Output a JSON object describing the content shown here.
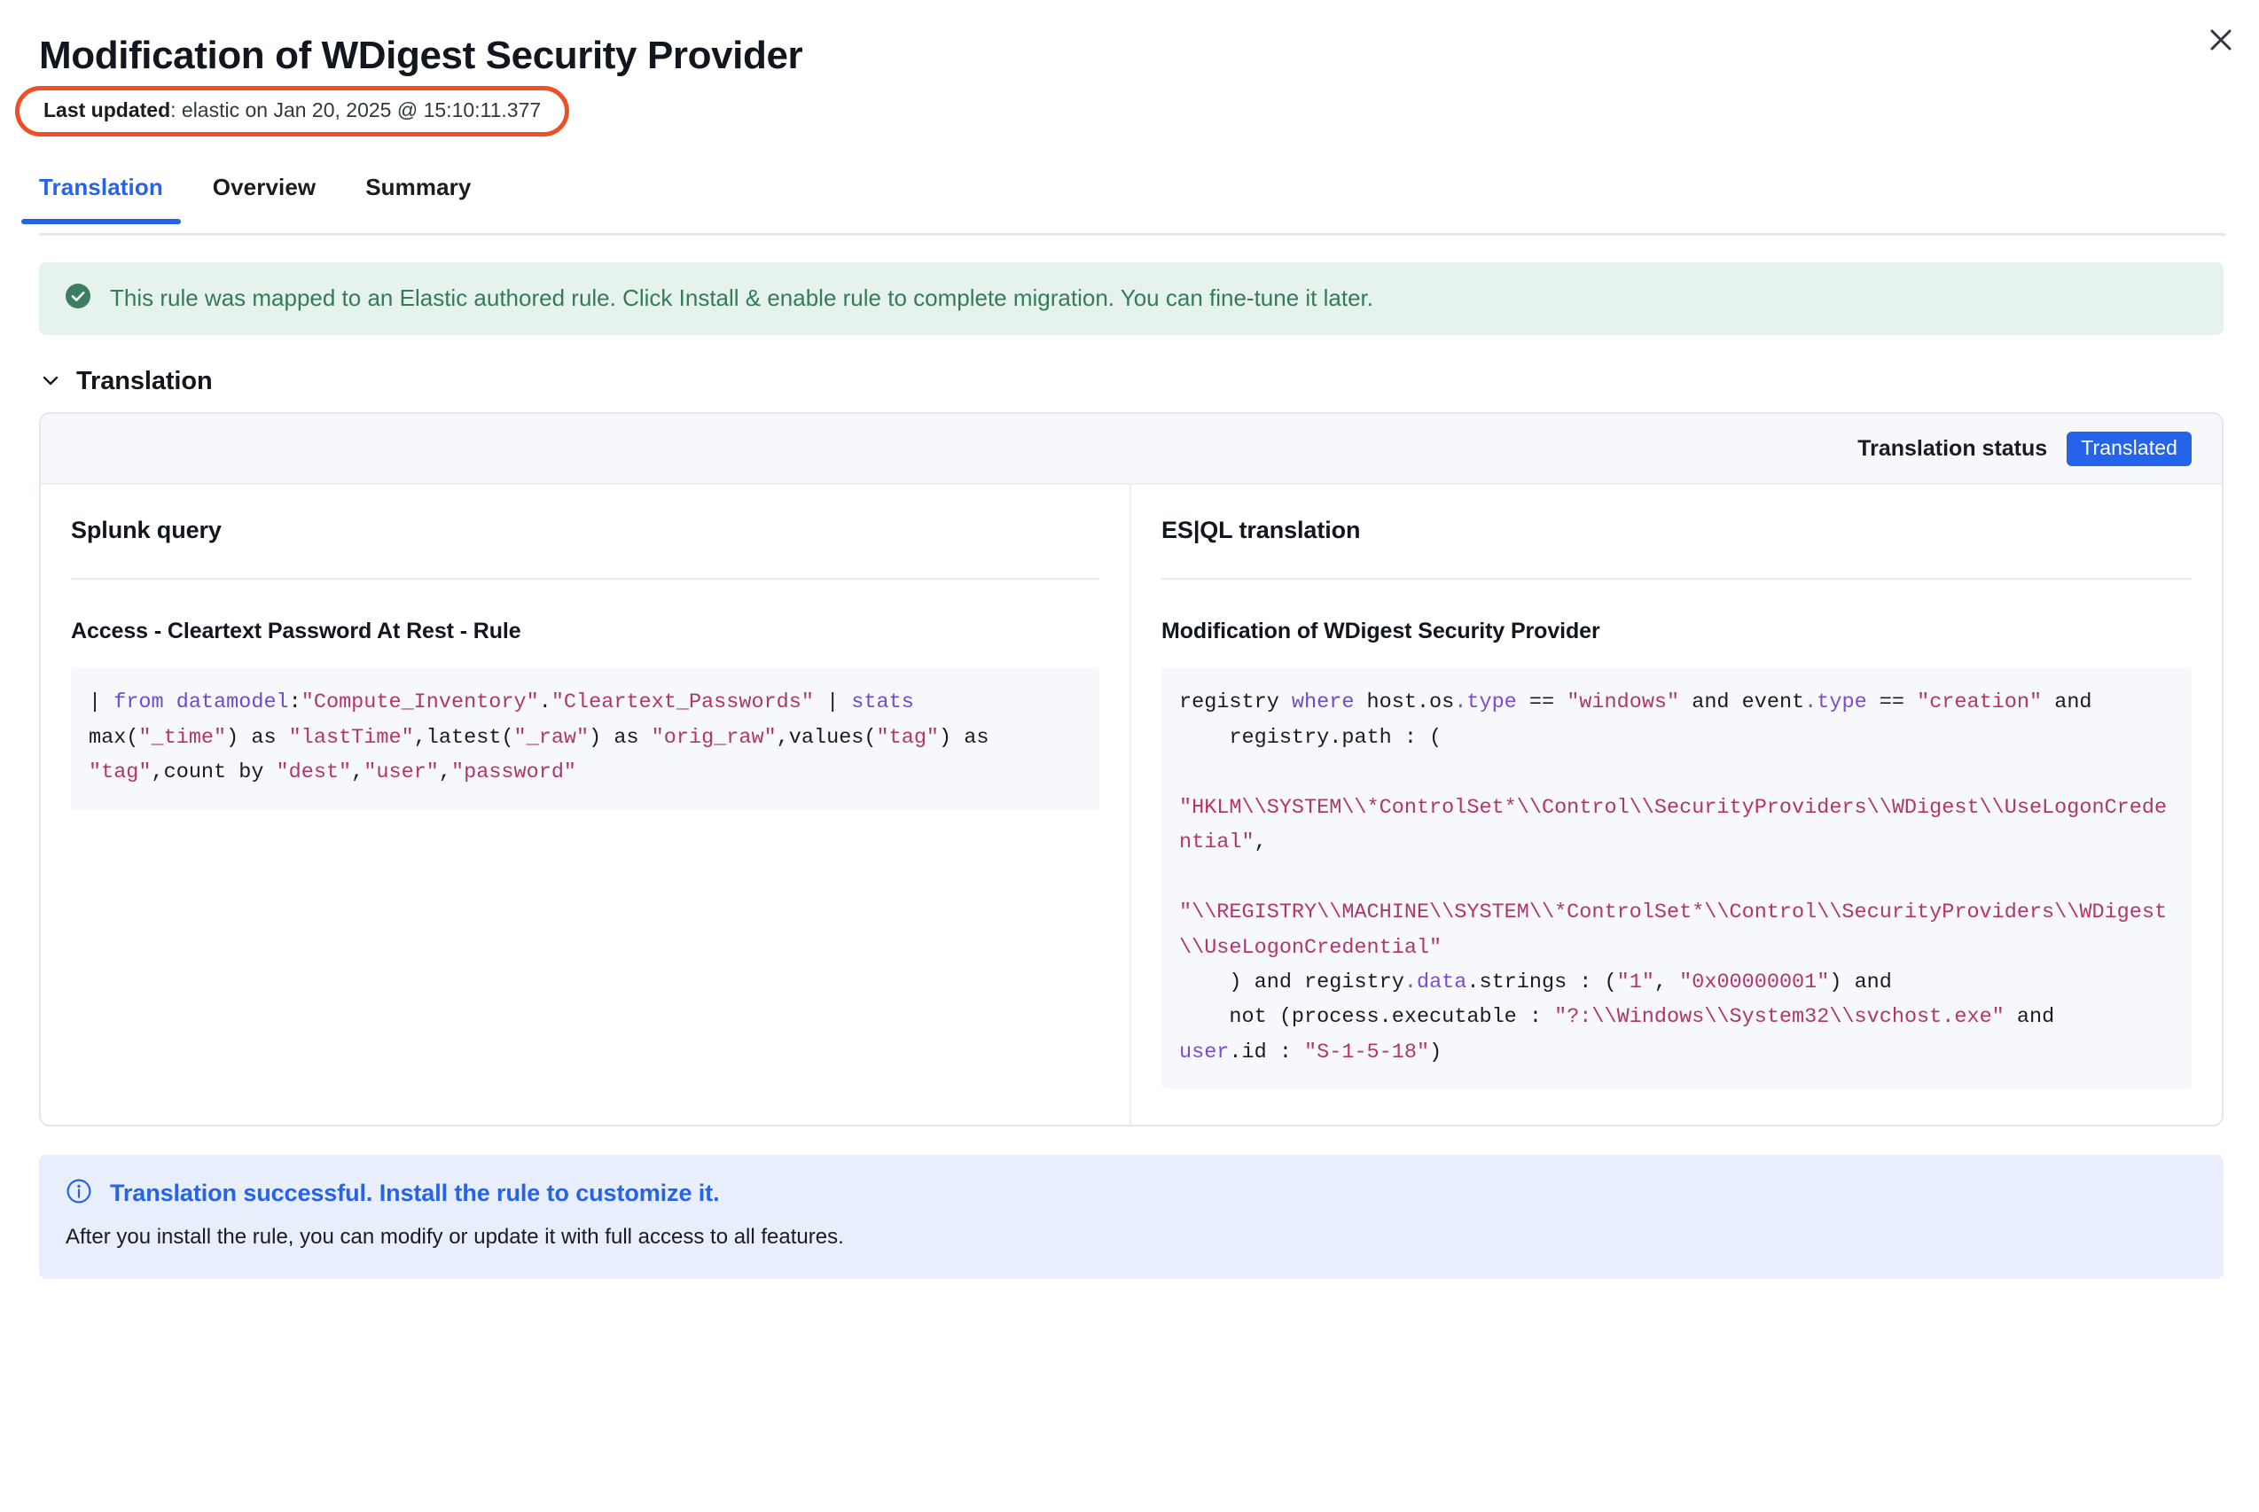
{
  "window": {
    "close_label": "Close",
    "close_icon": "close-icon"
  },
  "header": {
    "title": "Modification of WDigest Security Provider",
    "last_updated_label": "Last updated",
    "last_updated_value": ": elastic on Jan 20, 2025 @ 15:10:11.377",
    "highlight_color": "#f04e23"
  },
  "tabs": {
    "items": [
      {
        "label": "Translation",
        "active": true
      },
      {
        "label": "Overview",
        "active": false
      },
      {
        "label": "Summary",
        "active": false
      }
    ],
    "active_color": "#2563eb"
  },
  "success_callout": {
    "icon": "check-circle-filled-icon",
    "text": "This rule was mapped to an Elastic authored rule. Click Install & enable rule to complete migration. You can fine-tune it later.",
    "text_color": "#357a5b",
    "background": "#e6f3ec"
  },
  "translation_section": {
    "title": "Translation",
    "collapse_icon": "chevron-down-icon",
    "status_label": "Translation status",
    "status_badge": "Translated",
    "status_badge_color": "#2563eb",
    "left": {
      "column_title": "Splunk query",
      "query_name": "Access - Cleartext Password At Rest - Rule",
      "code_tokens": [
        {
          "t": "| ",
          "c": "pl"
        },
        {
          "t": "from datamodel",
          "c": "k"
        },
        {
          "t": ":",
          "c": "pl"
        },
        {
          "t": "\"Compute_Inventory\"",
          "c": "s"
        },
        {
          "t": ".",
          "c": "pl"
        },
        {
          "t": "\"Cleartext_Passwords\"",
          "c": "s"
        },
        {
          "t": " | ",
          "c": "pl"
        },
        {
          "t": "stats",
          "c": "k"
        },
        {
          "t": "\nmax(",
          "c": "pl"
        },
        {
          "t": "\"_time\"",
          "c": "s"
        },
        {
          "t": ") as ",
          "c": "pl"
        },
        {
          "t": "\"lastTime\"",
          "c": "s"
        },
        {
          "t": ",latest(",
          "c": "pl"
        },
        {
          "t": "\"_raw\"",
          "c": "s"
        },
        {
          "t": ") as ",
          "c": "pl"
        },
        {
          "t": "\"orig_raw\"",
          "c": "s"
        },
        {
          "t": ",values(",
          "c": "pl"
        },
        {
          "t": "\"tag\"",
          "c": "s"
        },
        {
          "t": ") as\n",
          "c": "pl"
        },
        {
          "t": "\"tag\"",
          "c": "s"
        },
        {
          "t": ",count by ",
          "c": "pl"
        },
        {
          "t": "\"dest\"",
          "c": "s"
        },
        {
          "t": ",",
          "c": "pl"
        },
        {
          "t": "\"user\"",
          "c": "s"
        },
        {
          "t": ",",
          "c": "pl"
        },
        {
          "t": "\"password\"",
          "c": "s"
        }
      ],
      "code_plain": "| from datamodel:\"Compute_Inventory\".\"Cleartext_Passwords\" | stats max(\"_time\") as \"lastTime\",latest(\"_raw\") as \"orig_raw\",values(\"tag\") as \"tag\",count by \"dest\",\"user\",\"password\""
    },
    "right": {
      "column_title": "ES|QL translation",
      "query_name": "Modification of WDigest Security Provider",
      "code_tokens": [
        {
          "t": "registry ",
          "c": "pl"
        },
        {
          "t": "where",
          "c": "k"
        },
        {
          "t": " host.os",
          "c": "pl"
        },
        {
          "t": ".type",
          "c": "p"
        },
        {
          "t": " == ",
          "c": "pl"
        },
        {
          "t": "\"windows\"",
          "c": "s"
        },
        {
          "t": " and event",
          "c": "pl"
        },
        {
          "t": ".type",
          "c": "p"
        },
        {
          "t": " == ",
          "c": "pl"
        },
        {
          "t": "\"creation\"",
          "c": "s"
        },
        {
          "t": " and\n    registry.path : (\n\n",
          "c": "pl"
        },
        {
          "t": "\"HKLM\\\\SYSTEM\\\\*ControlSet*\\\\Control\\\\SecurityProviders\\\\WDigest\\\\UseLogonCredential\"",
          "c": "s"
        },
        {
          "t": ",\n\n",
          "c": "pl"
        },
        {
          "t": "\"\\\\REGISTRY\\\\MACHINE\\\\SYSTEM\\\\*ControlSet*\\\\Control\\\\SecurityProviders\\\\WDigest\\\\UseLogonCredential\"",
          "c": "s"
        },
        {
          "t": "\n    ) and registry",
          "c": "pl"
        },
        {
          "t": ".data",
          "c": "p"
        },
        {
          "t": ".strings : (",
          "c": "pl"
        },
        {
          "t": "\"1\"",
          "c": "s"
        },
        {
          "t": ", ",
          "c": "pl"
        },
        {
          "t": "\"0x00000001\"",
          "c": "s"
        },
        {
          "t": ") and\n    not (process.executable : ",
          "c": "pl"
        },
        {
          "t": "\"?:\\\\Windows\\\\System32\\\\svchost.exe\"",
          "c": "s"
        },
        {
          "t": " and\n",
          "c": "pl"
        },
        {
          "t": "user",
          "c": "p"
        },
        {
          "t": ".id : ",
          "c": "pl"
        },
        {
          "t": "\"S-1-5-18\"",
          "c": "s"
        },
        {
          "t": ")",
          "c": "pl"
        }
      ],
      "code_plain": "registry where host.os.type == \"windows\" and event.type == \"creation\" and\n    registry.path : (\n\n\"HKLM\\\\SYSTEM\\\\*ControlSet*\\\\Control\\\\SecurityProviders\\\\WDigest\\\\UseLogonCredential\",\n\n\"\\\\REGISTRY\\\\MACHINE\\\\SYSTEM\\\\*ControlSet*\\\\Control\\\\SecurityProviders\\\\WDigest\\\\UseLogonCredential\"\n    ) and registry.data.strings : (\"1\", \"0x00000001\") and\n    not (process.executable : \"?:\\\\Windows\\\\System32\\\\svchost.exe\" and\nuser.id : \"S-1-5-18\")"
    }
  },
  "info_callout": {
    "icon": "info-circle-icon",
    "title": "Translation successful. Install the rule to customize it.",
    "description": "After you install the rule, you can modify or update it with full access to all features.",
    "title_color": "#2563eb",
    "background": "#e8eefb"
  }
}
